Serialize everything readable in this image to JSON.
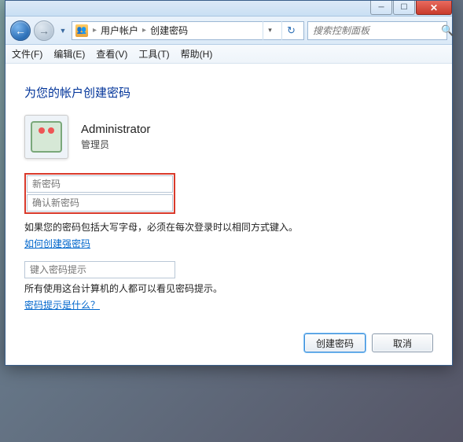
{
  "window": {
    "min_tooltip": "Minimize",
    "max_tooltip": "Maximize",
    "close_tooltip": "Close"
  },
  "nav": {
    "back_glyph": "←",
    "fwd_glyph": "→",
    "refresh_glyph": "↻"
  },
  "breadcrumb": {
    "items": [
      "用户帐户",
      "创建密码"
    ]
  },
  "search": {
    "placeholder": "搜索控制面板"
  },
  "menu": {
    "file": "文件(F)",
    "edit": "编辑(E)",
    "view": "查看(V)",
    "tools": "工具(T)",
    "help": "帮助(H)"
  },
  "page": {
    "heading": "为您的帐户创建密码",
    "user_name": "Administrator",
    "user_role": "管理员",
    "pw_new_placeholder": "新密码",
    "pw_confirm_placeholder": "确认新密码",
    "caps_note": "如果您的密码包括大写字母，必须在每次登录时以相同方式键入。",
    "strong_link": "如何创建强密码",
    "hint_placeholder": "键入密码提示",
    "hint_note": "所有使用这台计算机的人都可以看见密码提示。",
    "hint_link": "密码提示是什么？",
    "btn_create": "创建密码",
    "btn_cancel": "取消"
  }
}
